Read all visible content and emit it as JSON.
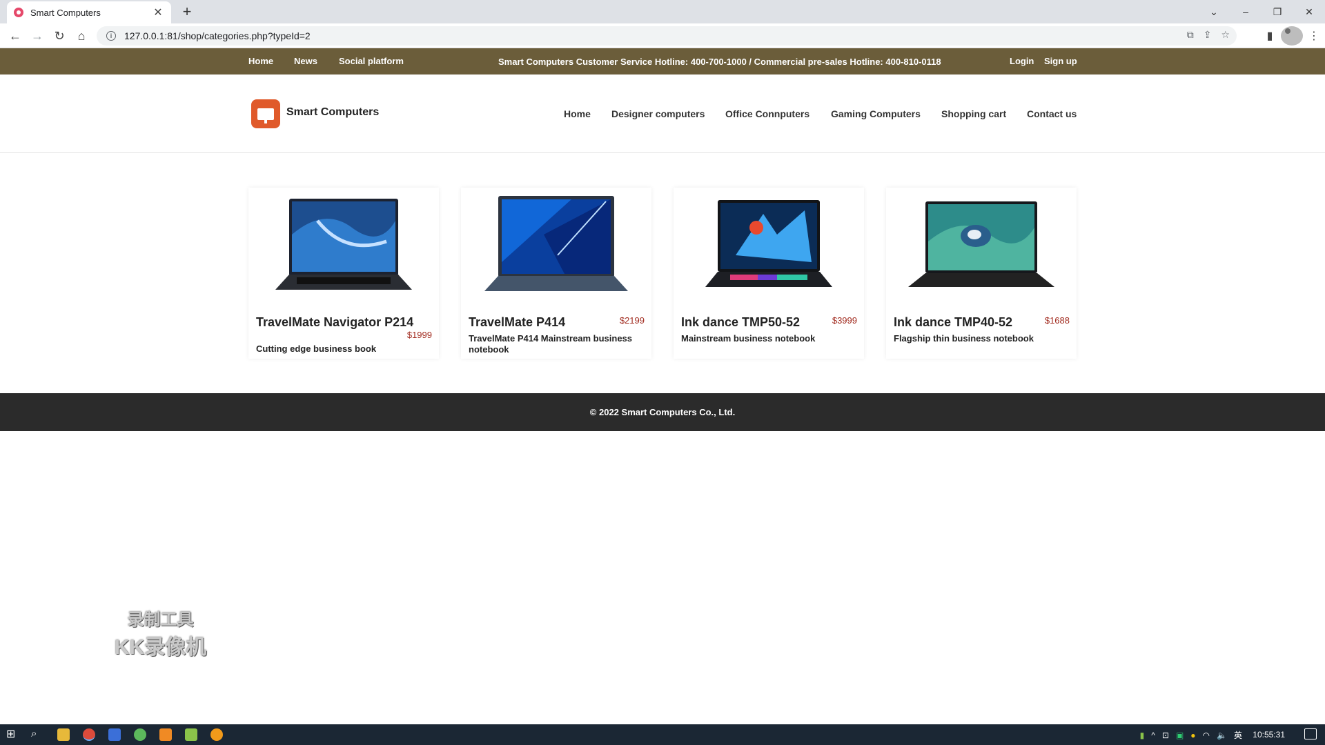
{
  "browser": {
    "tab_title": "Smart Computers",
    "url": "127.0.0.1:81/shop/categories.php?typeId=2"
  },
  "topbar": {
    "links_left": [
      "Home",
      "News",
      "Social platform"
    ],
    "hotline": "Smart Computers Customer Service Hotline:  400-700-1000 / Commercial pre-sales Hotline:  400-810-0118",
    "links_right": [
      "Login",
      "Sign up"
    ]
  },
  "header": {
    "brand": "Smart Computers",
    "nav": [
      "Home",
      "Designer computers",
      "Office Connputers",
      "Gaming Computers",
      "Shopping cart",
      "Contact us"
    ]
  },
  "products": [
    {
      "name": "TravelMate Navigator P214",
      "price": "$1999",
      "description": "Cutting edge business book"
    },
    {
      "name": "TravelMate P414",
      "price": "$2199",
      "description": "TravelMate P414 Mainstream business notebook"
    },
    {
      "name": "Ink dance TMP50-52",
      "price": "$3999",
      "description": "Mainstream business notebook"
    },
    {
      "name": "Ink dance TMP40-52",
      "price": "$1688",
      "description": "Flagship thin business notebook"
    }
  ],
  "footer": {
    "copyright": "© 2022 Smart Computers Co., Ltd."
  },
  "watermark": {
    "line1": "录制工具",
    "line2": "KK录像机"
  },
  "taskbar": {
    "time": "10:55:31",
    "ime": "英"
  },
  "colors": {
    "topbar_bg": "#6b5d3a",
    "logo": "#e05a2b",
    "price": "#a12b1f",
    "footer_bg": "#2b2b2b"
  }
}
